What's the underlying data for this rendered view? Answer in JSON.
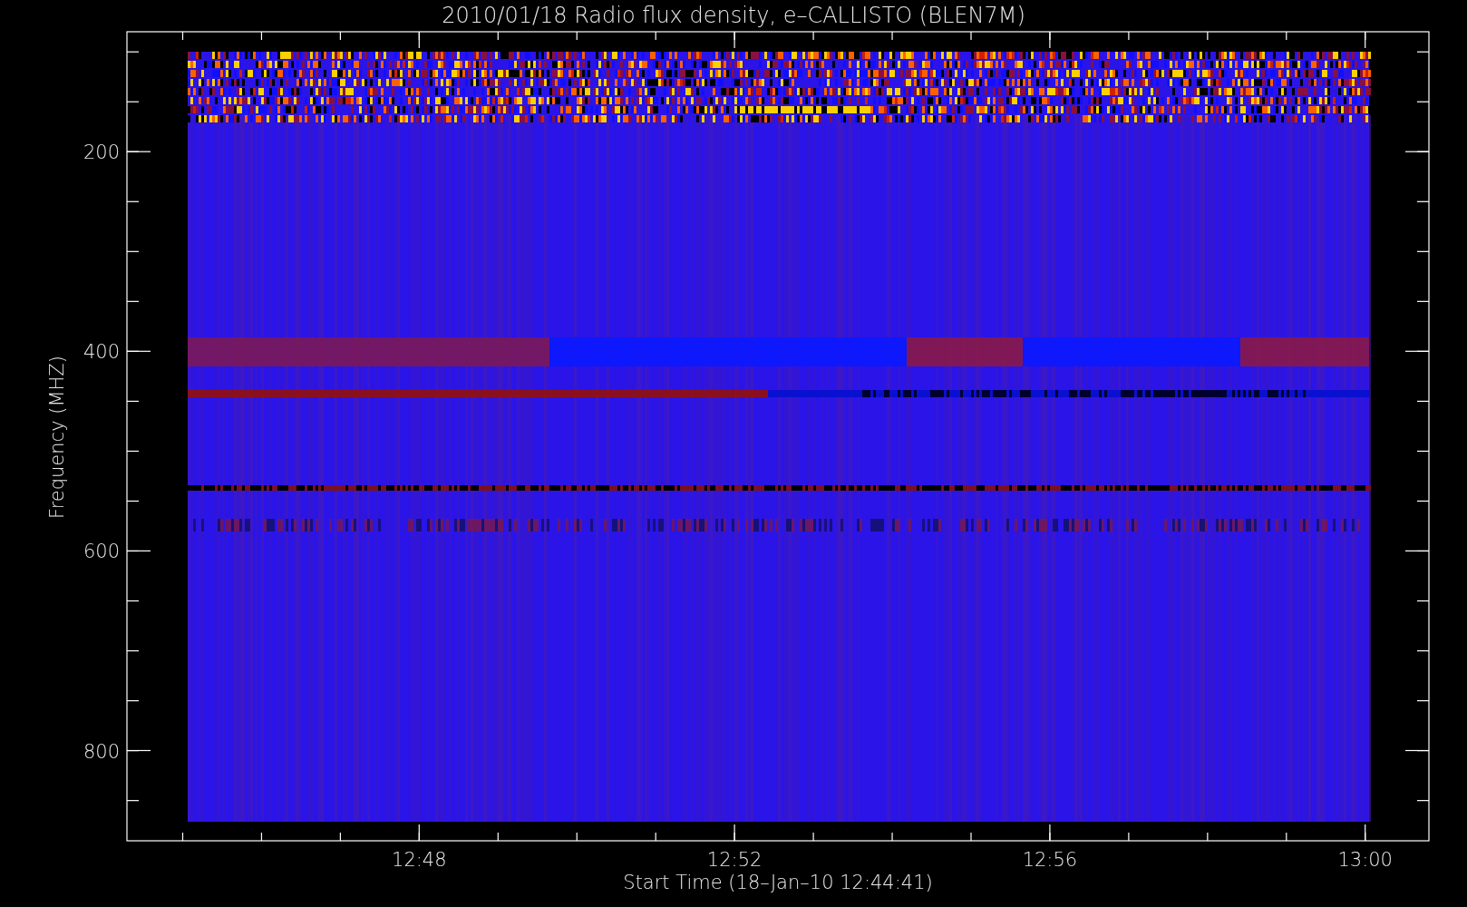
{
  "title": "2010/01/18  Radio flux density, e–CALLISTO (BLEN7M)",
  "y_axis": {
    "label": "Frequency (MHZ)",
    "tick_labels": [
      "200",
      "400",
      "600",
      "800"
    ]
  },
  "x_axis": {
    "label": "Start Time (18–Jan–10 12:44:41)",
    "tick_labels": [
      "12:48",
      "12:52",
      "12:56",
      "13:00"
    ]
  }
}
